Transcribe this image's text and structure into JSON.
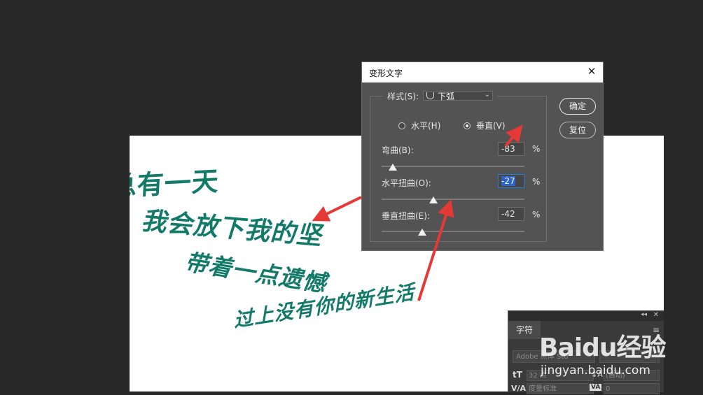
{
  "document": {
    "warped_lines": [
      "总有一天",
      "我会放下我的坚",
      "带着一点遗憾",
      "过上没有你的新生活"
    ]
  },
  "dialog": {
    "title": "变形文字",
    "style_label": "样式(S):",
    "style_value": "下弧",
    "horizontal_label": "水平(H)",
    "vertical_label": "垂直(V)",
    "orientation_selected": "vertical",
    "bend": {
      "label": "弯曲(B):",
      "value": "-83",
      "unit": "%"
    },
    "h_distort": {
      "label": "水平扭曲(O):",
      "value": "-27",
      "unit": "%"
    },
    "v_distort": {
      "label": "垂直扭曲(E):",
      "value": "-42",
      "unit": "%"
    },
    "ok_label": "确定",
    "reset_label": "复位"
  },
  "char_panel": {
    "tab_label": "字符",
    "font_family": "Adobe 黑体 Std",
    "size": "32 点",
    "leading": "(自动)",
    "kerning": "度量标准",
    "tracking": "0"
  },
  "watermark": {
    "brand": "Baidu经验",
    "url": "jingyan.baidu.com"
  },
  "colors": {
    "app_bg": "#282828",
    "dialog_bg": "#535353",
    "text_green": "#137a6a",
    "arrow_red": "#e53935"
  }
}
